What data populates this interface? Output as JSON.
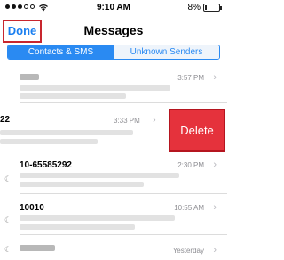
{
  "status": {
    "time": "9:10 AM",
    "battery": "8%"
  },
  "nav": {
    "done_label": "Done",
    "title": "Messages"
  },
  "segments": [
    "Contacts & SMS",
    "Unknown Senders"
  ],
  "rows": [
    {
      "name": "",
      "time": "3:57 PM"
    },
    {
      "name": "22",
      "time": "3:33 PM"
    },
    {
      "name": "10-65585292",
      "time": "2:30 PM"
    },
    {
      "name": "10010",
      "time": "10:55 AM"
    },
    {
      "name": "",
      "time": "Yesterday"
    }
  ],
  "delete_label": "Delete",
  "colors": {
    "accent": "#2a8af2",
    "delete": "#e5323c",
    "highlight": "#c8262e"
  }
}
